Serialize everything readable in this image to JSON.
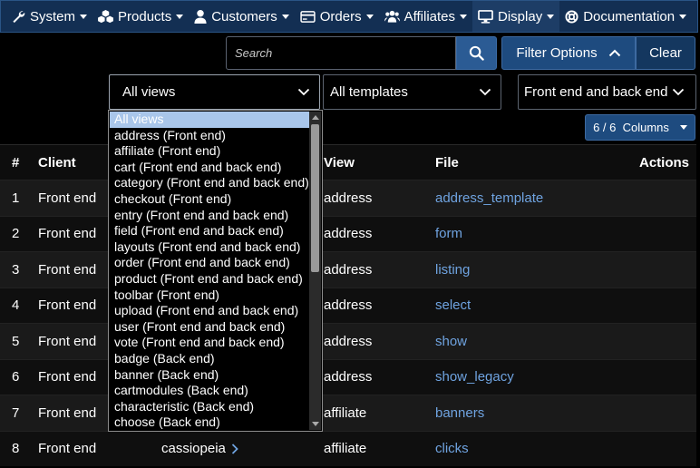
{
  "nav": {
    "items": [
      {
        "label": "System",
        "icon": "wrench-icon"
      },
      {
        "label": "Products",
        "icon": "cubes-icon"
      },
      {
        "label": "Customers",
        "icon": "user-icon"
      },
      {
        "label": "Orders",
        "icon": "credit-card-icon"
      },
      {
        "label": "Affiliates",
        "icon": "users-icon"
      },
      {
        "label": "Display",
        "icon": "desktop-icon"
      },
      {
        "label": "Documentation",
        "icon": "life-ring-icon"
      }
    ]
  },
  "search": {
    "placeholder": "Search"
  },
  "filter_options_label": "Filter Options",
  "clear_label": "Clear",
  "filters": {
    "views": "All views",
    "templates": "All templates",
    "client": "Front end and back end"
  },
  "columns": {
    "label": "6 / 6  Columns"
  },
  "table": {
    "headers": {
      "num": "#",
      "client": "Client",
      "view": "View",
      "file": "File",
      "actions": "Actions"
    },
    "rows": [
      {
        "num": "1",
        "client": "Front end",
        "template": "",
        "view": "address",
        "file": "address_template"
      },
      {
        "num": "2",
        "client": "Front end",
        "template": "",
        "view": "address",
        "file": "form"
      },
      {
        "num": "3",
        "client": "Front end",
        "template": "",
        "view": "address",
        "file": "listing"
      },
      {
        "num": "4",
        "client": "Front end",
        "template": "",
        "view": "address",
        "file": "select"
      },
      {
        "num": "5",
        "client": "Front end",
        "template": "",
        "view": "address",
        "file": "show"
      },
      {
        "num": "6",
        "client": "Front end",
        "template": "",
        "view": "address",
        "file": "show_legacy"
      },
      {
        "num": "7",
        "client": "Front end",
        "template": "",
        "view": "affiliate",
        "file": "banners"
      },
      {
        "num": "8",
        "client": "Front end",
        "template": "cassiopeia",
        "view": "affiliate",
        "file": "clicks"
      }
    ]
  },
  "dropdown": {
    "options": [
      "All views",
      "address (Front end)",
      "affiliate (Front end)",
      "cart (Front end and back end)",
      "category (Front end and back end)",
      "checkout (Front end)",
      "entry (Front end and back end)",
      "field (Front end and back end)",
      "layouts (Front end and back end)",
      "order (Front end and back end)",
      "product (Front end and back end)",
      "toolbar (Front end)",
      "upload (Front end and back end)",
      "user (Front end and back end)",
      "vote (Front end and back end)",
      "badge (Back end)",
      "banner (Back end)",
      "cartmodules (Back end)",
      "characteristic (Back end)",
      "choose (Back end)"
    ],
    "selected_index": 0
  },
  "colors": {
    "nav_bg": "#132f53",
    "primary": "#2b5b94",
    "link": "#6fa3e0",
    "selected_option": "#a9c6ea"
  }
}
